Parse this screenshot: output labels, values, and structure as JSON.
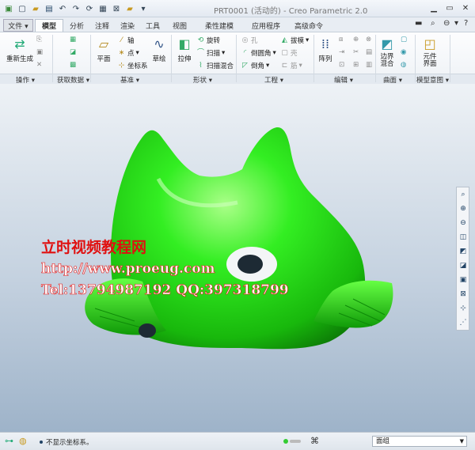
{
  "window": {
    "title": "PRT0001 (活动的) - Creo Parametric 2.0"
  },
  "tabs": [
    {
      "label": "文件 ▾"
    },
    {
      "label": "模型"
    },
    {
      "label": "分析"
    },
    {
      "label": "注释"
    },
    {
      "label": "渲染"
    },
    {
      "label": "工具"
    },
    {
      "label": "视图"
    },
    {
      "label": "柔性建模"
    },
    {
      "label": "应用程序"
    },
    {
      "label": "高级命令"
    }
  ],
  "ribbon": {
    "regenerate": "重新生成",
    "plane": "平面",
    "axis": "轴",
    "point": "点",
    "csys": "坐标系",
    "sketch": "草绘",
    "extrude": "拉伸",
    "revolve": "旋转",
    "sweep": "扫描",
    "swept_blend": "扫描混合",
    "hole": "孔",
    "round": "倒圆角",
    "chamfer": "倒角",
    "draft": "拔模",
    "shell": "壳",
    "rib": "筋",
    "pattern": "阵列",
    "boundary_blend": "边界\n混合",
    "component_interface": "元件\n界面",
    "groups": {
      "operations": "操作 ▾",
      "get_data": "获取数据 ▾",
      "datum": "基准 ▾",
      "shapes": "形状 ▾",
      "engineering": "工程 ▾",
      "editing": "编辑 ▾",
      "surfaces": "曲面 ▾",
      "model_intent": "模型意图 ▾"
    }
  },
  "watermark": {
    "line1": "立时视频教程网",
    "line2": "http://www.proeug.com",
    "line3": "Tel:13794987192  QQ:397318799"
  },
  "status": {
    "message": "不显示坐标系。",
    "filter": "面组"
  },
  "colors": {
    "model": "#22dd11",
    "background_top": "#eef2f6",
    "background_bottom": "#9eb3c9"
  }
}
